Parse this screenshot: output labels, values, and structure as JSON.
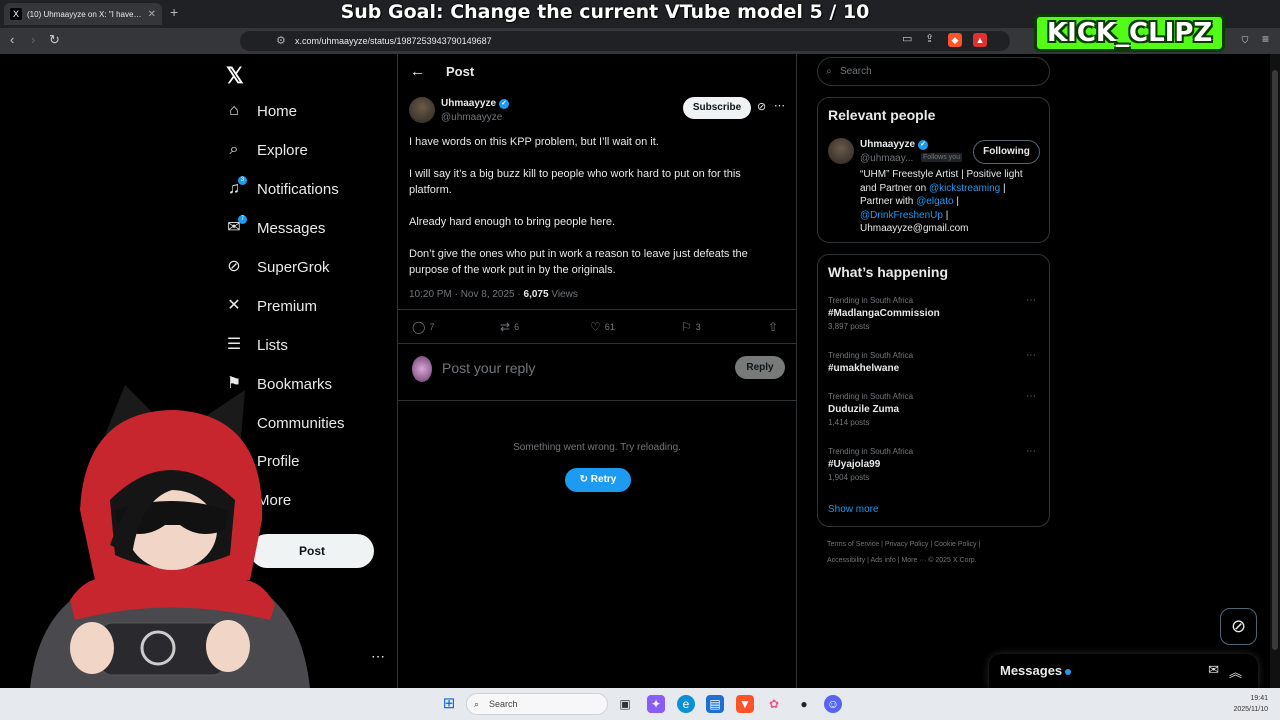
{
  "browser": {
    "tab_title": "(10) Uhmaayyze on X: \"I have wo",
    "url": "x.com/uhmaayyze/status/1987253943790149687"
  },
  "stream": {
    "overlay_title": "Sub Goal: Change the current VTube model  5 / 10",
    "watermark": "KICK_CLIPZ"
  },
  "nav": {
    "items": [
      {
        "label": "Home",
        "icon": "home-icon"
      },
      {
        "label": "Explore",
        "icon": "search-icon"
      },
      {
        "label": "Notifications",
        "icon": "bell-icon",
        "badge": "3"
      },
      {
        "label": "Messages",
        "icon": "mail-icon",
        "badge": "7"
      },
      {
        "label": "SuperGrok",
        "icon": "grok-icon"
      },
      {
        "label": "Premium",
        "icon": "x-icon"
      },
      {
        "label": "Lists",
        "icon": "list-icon"
      },
      {
        "label": "Bookmarks",
        "icon": "bookmark-icon"
      },
      {
        "label": "Communities",
        "icon": "people-icon"
      },
      {
        "label": "Profile",
        "icon": "person-icon"
      },
      {
        "label": "More",
        "icon": "more-icon"
      }
    ],
    "post_button": "Post"
  },
  "main": {
    "header": "Post",
    "author": {
      "name": "Uhmaayyze",
      "handle": "@uhmaayyze"
    },
    "subscribe": "Subscribe",
    "paragraphs": [
      "I have words on this KPP problem, but I’ll wait on it.",
      "I will say it’s a big buzz kill to people who work hard to put on for this platform.",
      "Already hard enough to bring people here.",
      "Don’t give the ones who put in work a reason to leave just defeats the purpose of the work put in by the originals."
    ],
    "timestamp": "10:20 PM · Nov 8, 2025 · ",
    "views_count": "6,075",
    "views_label": " Views",
    "actions": {
      "replies": "7",
      "reposts": "6",
      "likes": "61",
      "bookmarks": "3"
    },
    "reply_placeholder": "Post your reply",
    "reply_button": "Reply",
    "error_message": "Something went wrong. Try reloading.",
    "retry_button": "Retry"
  },
  "right": {
    "search_placeholder": "Search",
    "relevant": {
      "title": "Relevant people",
      "name": "Uhmaayyze",
      "handle": "@uhmaay...",
      "follows_you": "Follows you",
      "following_button": "Following",
      "bio_1": "“UHM” Freestyle Artist | Positive light and Partner on ",
      "bio_link_1": "@kickstreaming",
      "bio_2": " | Partner with ",
      "bio_link_2": "@elgato",
      "bio_3": " | ",
      "bio_link_3": "@DrinkFreshenUp",
      "bio_4": " | Uhmaayyze@gmail.com"
    },
    "happening": {
      "title": "What’s happening",
      "trends": [
        {
          "context": "Trending in South Africa",
          "name": "#MadlangaCommission",
          "count": "3,897 posts"
        },
        {
          "context": "Trending in South Africa",
          "name": "#umakhelwane",
          "count": ""
        },
        {
          "context": "Trending in South Africa",
          "name": "Duduzile Zuma",
          "count": "1,414 posts"
        },
        {
          "context": "Trending in South Africa",
          "name": "#Uyajola99",
          "count": "1,904 posts"
        }
      ],
      "show_more": "Show more"
    },
    "footer_line1": "Terms of Service  |  Privacy Policy  |  Cookie Policy  |",
    "footer_line2": "Accessibility  |  Ads info  |  More ···  © 2025 X Corp."
  },
  "messages_drawer": {
    "title": "Messages"
  },
  "taskbar": {
    "search": "Search",
    "time": "19:41",
    "date": "2025/11/10"
  },
  "colors": {
    "accent": "#1d9bf0",
    "background": "#000000",
    "border": "#2f3336",
    "kick_green": "#53fc18"
  }
}
